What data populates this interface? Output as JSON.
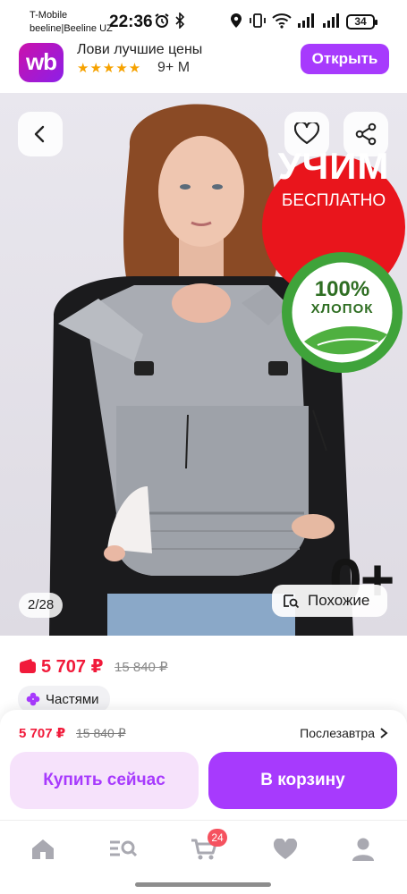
{
  "status_bar": {
    "carrier_line1": "T-Mobile",
    "carrier_line2": "beeline|Beeline UZ",
    "time": "22:36",
    "battery": "34"
  },
  "app_banner": {
    "logo_text": "wb",
    "title": "Лови лучшие цены",
    "stars": "★★★★★",
    "rating_count": "9+ M",
    "open_label": "Открыть"
  },
  "gallery": {
    "promo_main": "УЧИМ",
    "promo_sub": "БЕСПЛАТНО",
    "cotton_percent": "100%",
    "cotton_word": "ХЛОПОК",
    "age_mark": "0+",
    "counter": "2/28",
    "similar_label": "Похожие"
  },
  "price": {
    "current": "5 707 ₽",
    "old": "15 840 ₽",
    "installments_label": "Частями"
  },
  "buy_panel": {
    "price": "5 707 ₽",
    "old_price": "15 840 ₽",
    "delivery": "Послезавтра",
    "buy_now_label": "Купить сейчас",
    "to_cart_label": "В корзину"
  },
  "tabbar": {
    "cart_count": "24",
    "icons": [
      "home-icon",
      "catalog-search-icon",
      "cart-icon",
      "heart-icon",
      "profile-icon"
    ]
  },
  "colors": {
    "brand_purple": "#a73afd",
    "price_red": "#f11a3a",
    "promo_red": "#e9151c",
    "cotton_green": "#3fa33a"
  }
}
